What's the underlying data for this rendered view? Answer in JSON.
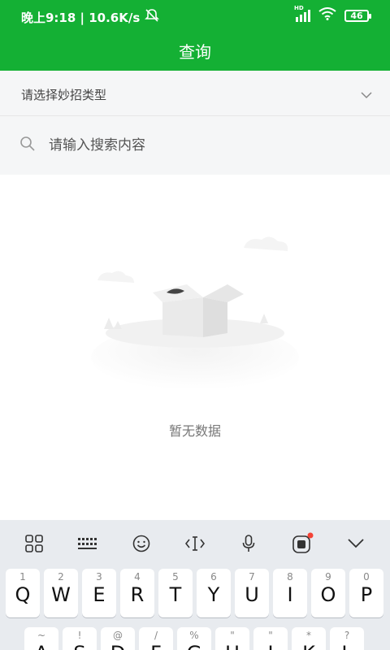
{
  "status_bar": {
    "time_speed": "晚上9:18 | 10.6K/s",
    "network": "HD",
    "battery": "46"
  },
  "header": {
    "title": "查询"
  },
  "type_select": {
    "placeholder": "请选择妙招类型"
  },
  "search": {
    "placeholder": "请输入搜索内容"
  },
  "empty_state": {
    "message": "暂无数据"
  },
  "keyboard": {
    "toolbar": [
      "grid-icon",
      "keyboard-icon",
      "emoji-icon",
      "text-cursor-icon",
      "microphone-icon",
      "mi-assistant-icon",
      "collapse-icon"
    ],
    "row1": [
      {
        "key": "Q",
        "hint": "1"
      },
      {
        "key": "W",
        "hint": "2"
      },
      {
        "key": "E",
        "hint": "3"
      },
      {
        "key": "R",
        "hint": "4"
      },
      {
        "key": "T",
        "hint": "5"
      },
      {
        "key": "Y",
        "hint": "6"
      },
      {
        "key": "U",
        "hint": "7"
      },
      {
        "key": "I",
        "hint": "8"
      },
      {
        "key": "O",
        "hint": "9"
      },
      {
        "key": "P",
        "hint": "0"
      }
    ],
    "row2": [
      {
        "key": "A",
        "hint": "~"
      },
      {
        "key": "S",
        "hint": "!"
      },
      {
        "key": "D",
        "hint": "@"
      },
      {
        "key": "F",
        "hint": "/"
      },
      {
        "key": "G",
        "hint": "%"
      },
      {
        "key": "H",
        "hint": "\""
      },
      {
        "key": "J",
        "hint": "\""
      },
      {
        "key": "K",
        "hint": "*"
      },
      {
        "key": "L",
        "hint": "?"
      }
    ]
  }
}
